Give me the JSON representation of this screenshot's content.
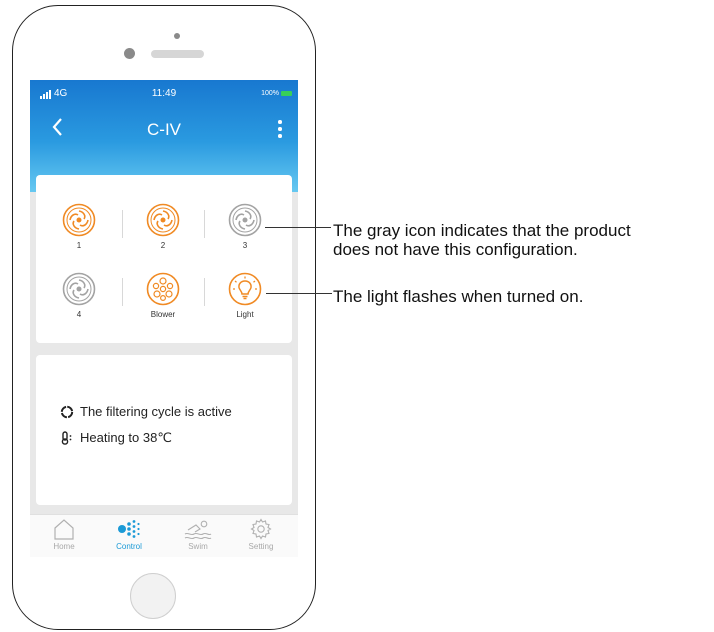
{
  "status_bar": {
    "network": "4G",
    "time": "11:49",
    "battery": "100%"
  },
  "header": {
    "title": "C-IV"
  },
  "controls": [
    {
      "label": "1",
      "icon": "pump-icon",
      "state": "available"
    },
    {
      "label": "2",
      "icon": "pump-icon",
      "state": "available"
    },
    {
      "label": "3",
      "icon": "pump-icon",
      "state": "unavailable"
    },
    {
      "label": "4",
      "icon": "pump-icon",
      "state": "unavailable"
    },
    {
      "label": "Blower",
      "icon": "blower-icon",
      "state": "available"
    },
    {
      "label": "Light",
      "icon": "light-bulb-icon",
      "state": "available"
    }
  ],
  "status_info": {
    "filtering": "The filtering cycle is active",
    "heating": "Heating to 38℃"
  },
  "tabs": [
    {
      "label": "Home",
      "icon": "home-icon",
      "active": false
    },
    {
      "label": "Control",
      "icon": "control-dots-icon",
      "active": true
    },
    {
      "label": "Swim",
      "icon": "swim-icon",
      "active": false
    },
    {
      "label": "Setting",
      "icon": "gear-icon",
      "active": false
    }
  ],
  "annotations": {
    "gray_icon_line1": "The gray icon indicates that the product",
    "gray_icon_line2": "does not have this configuration.",
    "light_note": "The light flashes when turned on."
  },
  "colors": {
    "accent": "#f08a24",
    "disabled": "#a3a3a3",
    "header_blue": "#1f86d6",
    "active_tab": "#1b9ad6"
  }
}
